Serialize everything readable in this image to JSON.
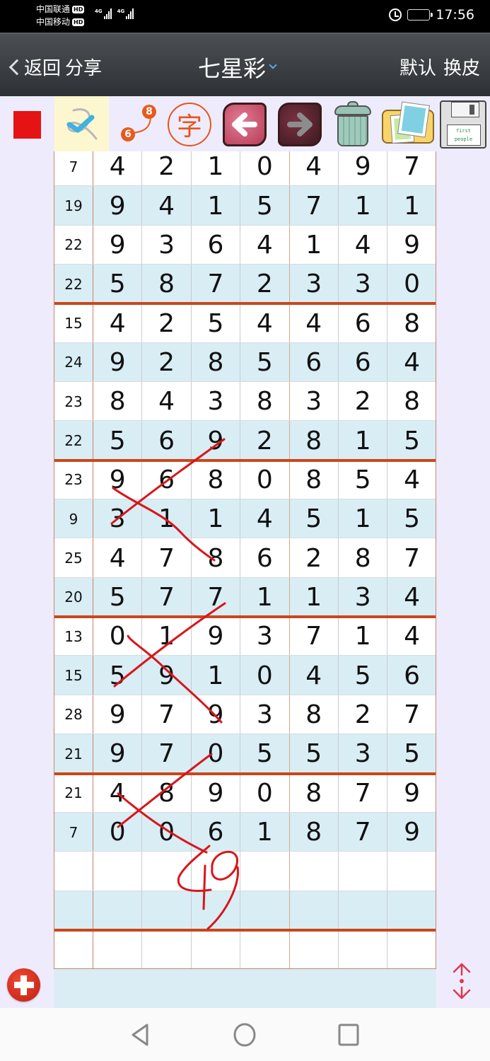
{
  "status_bar": {
    "carrier_1": "中国联通",
    "carrier_2": "中国移动",
    "hd_badge": "HD",
    "network_1": "4G",
    "network_2": "4G",
    "time": "17:56",
    "alarm_icon": "alarm-clock-icon",
    "battery_icon": "battery-icon"
  },
  "header": {
    "back_label": "返回",
    "share_label": "分享",
    "title": "七星彩",
    "default_label": "默认",
    "skin_label": "换皮"
  },
  "toolbar": {
    "pen_color": "#e51313",
    "tools": [
      {
        "name": "pen-tool",
        "icon": "check-pen-icon",
        "selected": true
      },
      {
        "name": "point-link-tool",
        "icon": "point-link-icon",
        "badge_a": "6",
        "badge_b": "8"
      },
      {
        "name": "text-tool",
        "icon": "character-icon",
        "glyph": "字"
      },
      {
        "name": "undo-tool",
        "icon": "arrow-left-icon",
        "glyph": "⬅"
      },
      {
        "name": "redo-tool",
        "icon": "arrow-right-icon",
        "glyph": "➡"
      },
      {
        "name": "clear-tool",
        "icon": "trash-icon"
      },
      {
        "name": "image-tool",
        "icon": "photo-folder-icon"
      },
      {
        "name": "save-tool",
        "icon": "floppy-disk-icon",
        "label_1": "first",
        "label_2": "people"
      }
    ]
  },
  "table": {
    "columns": [
      "sum",
      "d1",
      "d2",
      "d3",
      "d4",
      "d5",
      "d6",
      "d7"
    ],
    "rows": [
      {
        "sum": "7",
        "digits": [
          "4",
          "2",
          "1",
          "0",
          "4",
          "9",
          "7"
        ]
      },
      {
        "sum": "19",
        "digits": [
          "9",
          "4",
          "1",
          "5",
          "7",
          "1",
          "1"
        ]
      },
      {
        "sum": "22",
        "digits": [
          "9",
          "3",
          "6",
          "4",
          "1",
          "4",
          "9"
        ]
      },
      {
        "sum": "22",
        "digits": [
          "5",
          "8",
          "7",
          "2",
          "3",
          "3",
          "0"
        ]
      },
      {
        "sum": "15",
        "digits": [
          "4",
          "2",
          "5",
          "4",
          "4",
          "6",
          "8"
        ]
      },
      {
        "sum": "24",
        "digits": [
          "9",
          "2",
          "8",
          "5",
          "6",
          "6",
          "4"
        ]
      },
      {
        "sum": "23",
        "digits": [
          "8",
          "4",
          "3",
          "8",
          "3",
          "2",
          "8"
        ]
      },
      {
        "sum": "22",
        "digits": [
          "5",
          "6",
          "9",
          "2",
          "8",
          "1",
          "5"
        ]
      },
      {
        "sum": "23",
        "digits": [
          "9",
          "6",
          "8",
          "0",
          "8",
          "5",
          "4"
        ]
      },
      {
        "sum": "9",
        "digits": [
          "3",
          "1",
          "1",
          "4",
          "5",
          "1",
          "5"
        ]
      },
      {
        "sum": "25",
        "digits": [
          "4",
          "7",
          "8",
          "6",
          "2",
          "8",
          "7"
        ]
      },
      {
        "sum": "20",
        "digits": [
          "5",
          "7",
          "7",
          "1",
          "1",
          "3",
          "4"
        ]
      },
      {
        "sum": "13",
        "digits": [
          "0",
          "1",
          "9",
          "3",
          "7",
          "1",
          "4"
        ]
      },
      {
        "sum": "15",
        "digits": [
          "5",
          "9",
          "1",
          "0",
          "4",
          "5",
          "6"
        ]
      },
      {
        "sum": "28",
        "digits": [
          "9",
          "7",
          "9",
          "3",
          "8",
          "2",
          "7"
        ]
      },
      {
        "sum": "21",
        "digits": [
          "9",
          "7",
          "0",
          "5",
          "5",
          "3",
          "5"
        ]
      },
      {
        "sum": "21",
        "digits": [
          "4",
          "8",
          "9",
          "0",
          "8",
          "7",
          "9"
        ]
      },
      {
        "sum": "7",
        "digits": [
          "0",
          "0",
          "6",
          "1",
          "8",
          "7",
          "9"
        ]
      },
      {
        "sum": "",
        "digits": [
          "",
          "",
          "",
          "",
          "",
          "",
          ""
        ]
      },
      {
        "sum": "",
        "digits": [
          "",
          "",
          "",
          "",
          "",
          "",
          ""
        ]
      },
      {
        "sum": "",
        "digits": [
          "",
          "",
          "",
          "",
          "",
          "",
          ""
        ]
      }
    ],
    "group_size": 4
  },
  "annotations": {
    "ink_color": "#d8161b",
    "handwritten_text": "49"
  },
  "bottom": {
    "add_icon": "add-circle-icon",
    "scroll_icon": "scroll-up-down-icon"
  },
  "navbar": {
    "back_icon": "nav-back-icon",
    "home_icon": "nav-home-icon",
    "recents_icon": "nav-recents-icon"
  }
}
